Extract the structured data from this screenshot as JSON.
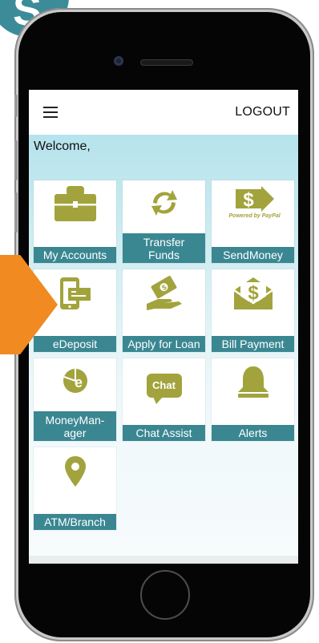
{
  "header": {
    "logout_label": "LOGOUT"
  },
  "welcome_text": "Welcome,",
  "tiles": [
    {
      "label": "My Accounts",
      "icon": "briefcase-icon"
    },
    {
      "label": "Transfer\nFunds",
      "icon": "transfer-arrows-icon"
    },
    {
      "label": "SendMoney",
      "icon": "paypal-send-money-icon",
      "icon_text": "Powered by PayPal"
    },
    {
      "label": "eDeposit",
      "icon": "mobile-check-deposit-icon"
    },
    {
      "label": "Apply for Loan",
      "icon": "loan-hand-icon"
    },
    {
      "label": "Bill Payment",
      "icon": "envelope-dollar-icon"
    },
    {
      "label": "MoneyMan-\nager",
      "icon": "money-manager-chart-icon"
    },
    {
      "label": "Chat Assist",
      "icon": "chat-bubble-icon",
      "icon_text": "Chat"
    },
    {
      "label": "Alerts",
      "icon": "bell-icon"
    },
    {
      "label": "ATM/Branch",
      "icon": "map-pin-icon"
    }
  ],
  "colors": {
    "tile_label_bg": "#3a8792",
    "icon_olive": "#a2a33c",
    "orange_accent": "#f08a21",
    "badge_teal": "#3b8c98"
  },
  "badge_glyph": "S"
}
